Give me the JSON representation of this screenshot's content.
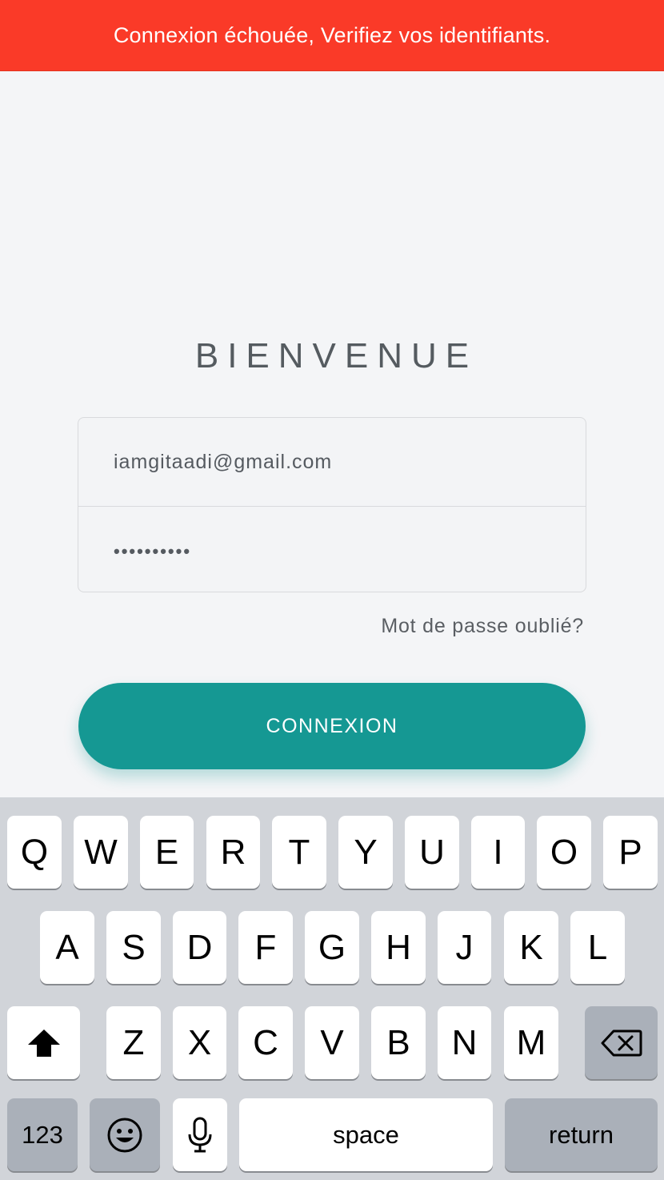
{
  "banner": {
    "message": "Connexion échouée, Verifiez vos identifiants."
  },
  "login": {
    "title": "BIENVENUE",
    "email_value": "iamgitaadi@gmail.com",
    "password_masked": "••••••••••",
    "forgot_label": "Mot de passe oublié?",
    "submit_label": "CONNEXION"
  },
  "keyboard": {
    "row1": [
      "Q",
      "W",
      "E",
      "R",
      "T",
      "Y",
      "U",
      "I",
      "O",
      "P"
    ],
    "row2": [
      "A",
      "S",
      "D",
      "F",
      "G",
      "H",
      "J",
      "K",
      "L"
    ],
    "row3": [
      "Z",
      "X",
      "C",
      "V",
      "B",
      "N",
      "M"
    ],
    "numbers_label": "123",
    "space_label": "space",
    "return_label": "return",
    "icons": [
      "shift-icon",
      "backspace-icon",
      "emoji-icon",
      "microphone-icon"
    ]
  },
  "colors": {
    "banner": "#fa3a28",
    "accent": "#159893",
    "background": "#f4f5f7"
  }
}
